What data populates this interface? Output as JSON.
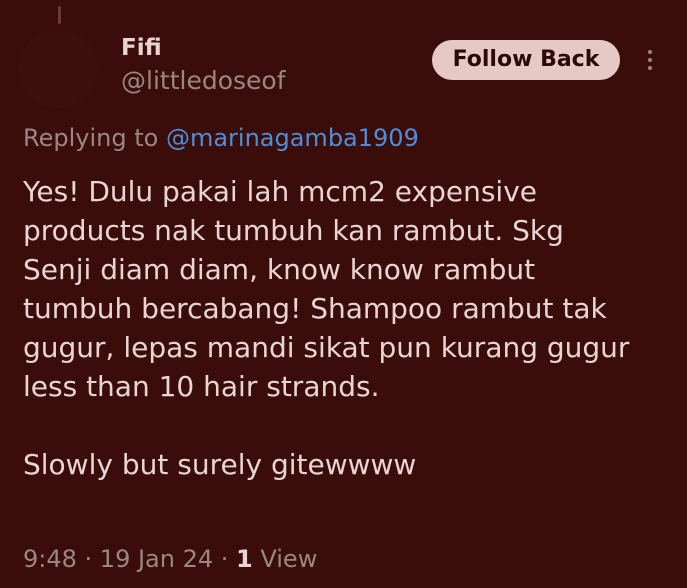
{
  "author": {
    "name": "Fifi",
    "handle": "@littledoseof"
  },
  "actions": {
    "follow_label": "Follow Back",
    "more_icon": "more-vertical-icon"
  },
  "reply": {
    "prefix": "Replying to",
    "mention": "@marinagamba1909"
  },
  "tweet": {
    "lines": [
      "Yes! Dulu pakai lah mcm2 expensive",
      "products nak tumbuh kan rambut. Skg",
      "Senji diam diam, know know rambut",
      "tumbuh bercabang! Shampoo rambut tak",
      "gugur, lepas mandi sikat pun kurang gugur",
      "less than 10 hair strands.",
      "",
      "Slowly but surely gitewwww"
    ]
  },
  "meta": {
    "time": "9:48",
    "separator1": " · ",
    "date": "19 Jan 24",
    "separator2": " · ",
    "views_count": "1",
    "views_label": " View"
  },
  "colors": {
    "background": "#3a0d0a",
    "text_primary": "#e8d5d2",
    "text_secondary": "#9a8682",
    "mention": "#4f8ed6",
    "button_bg": "#e6c9c4"
  }
}
